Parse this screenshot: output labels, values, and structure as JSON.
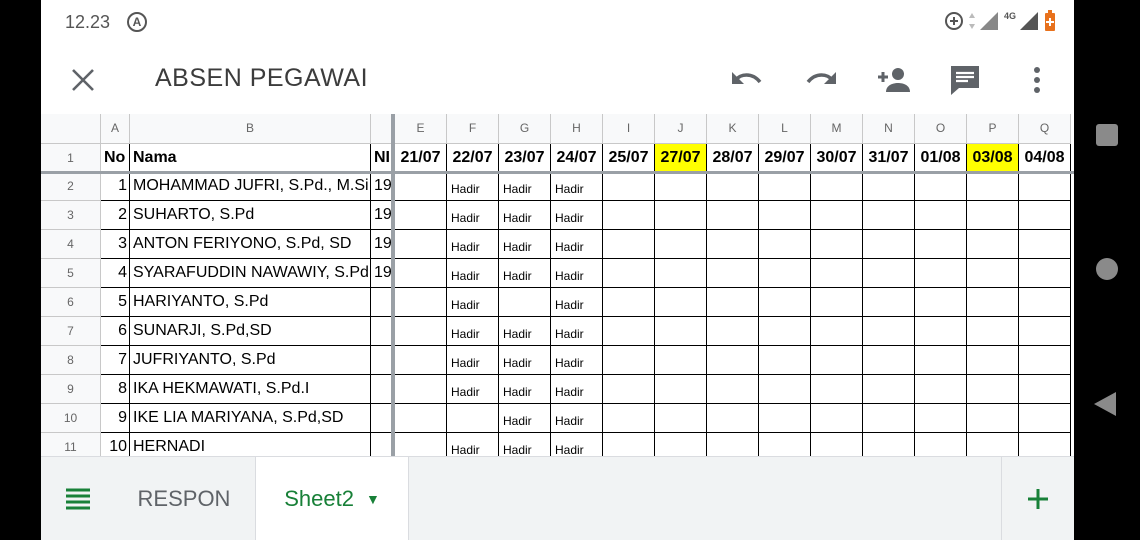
{
  "status": {
    "time": "12.23",
    "a_icon": "A",
    "network": "4G"
  },
  "toolbar": {
    "title": "ABSEN PEGAWAI"
  },
  "sheet": {
    "col_letters": [
      "A",
      "B",
      "",
      "E",
      "F",
      "G",
      "H",
      "I",
      "J",
      "K",
      "L",
      "M",
      "N",
      "O",
      "P",
      "Q"
    ],
    "header_row": {
      "row_num": "1",
      "no": "No",
      "nama": "Nama",
      "ni": "NI",
      "dates": [
        "21/07",
        "22/07",
        "23/07",
        "24/07",
        "25/07",
        "27/07",
        "28/07",
        "29/07",
        "30/07",
        "31/07",
        "01/08",
        "03/08",
        "04/08"
      ],
      "highlighted": [
        "27/07",
        "03/08"
      ],
      "highlight_color": "#ffff00"
    },
    "rows": [
      {
        "row_num": "2",
        "no": "1",
        "nama": "MOHAMMAD JUFRI, S.Pd., M.Si",
        "ni": "19",
        "att": [
          "",
          "Hadir",
          "Hadir",
          "Hadir"
        ]
      },
      {
        "row_num": "3",
        "no": "2",
        "nama": "SUHARTO, S.Pd",
        "ni": "19",
        "att": [
          "",
          "Hadir",
          "Hadir",
          "Hadir"
        ]
      },
      {
        "row_num": "4",
        "no": "3",
        "nama": "ANTON FERIYONO, S.Pd, SD",
        "ni": "19",
        "att": [
          "",
          "Hadir",
          "Hadir",
          "Hadir"
        ]
      },
      {
        "row_num": "5",
        "no": "4",
        "nama": "SYARAFUDDIN NAWAWIY, S.Pd.I",
        "ni": "19",
        "att": [
          "",
          "Hadir",
          "Hadir",
          "Hadir"
        ]
      },
      {
        "row_num": "6",
        "no": "5",
        "nama": "HARIYANTO, S.Pd",
        "ni": "",
        "att": [
          "",
          "Hadir",
          "",
          "Hadir"
        ]
      },
      {
        "row_num": "7",
        "no": "6",
        "nama": "SUNARJI, S.Pd,SD",
        "ni": "",
        "att": [
          "",
          "Hadir",
          "Hadir",
          "Hadir"
        ]
      },
      {
        "row_num": "8",
        "no": "7",
        "nama": "JUFRIYANTO, S.Pd",
        "ni": "",
        "att": [
          "",
          "Hadir",
          "Hadir",
          "Hadir"
        ]
      },
      {
        "row_num": "9",
        "no": "8",
        "nama": "IKA HEKMAWATI, S.Pd.I",
        "ni": "",
        "att": [
          "",
          "Hadir",
          "Hadir",
          "Hadir"
        ]
      },
      {
        "row_num": "10",
        "no": "9",
        "nama": "IKE LIA MARIYANA, S.Pd,SD",
        "ni": "",
        "att": [
          "",
          "",
          "Hadir",
          "Hadir"
        ]
      },
      {
        "row_num": "11",
        "no": "10",
        "nama": "HERNADI",
        "ni": "",
        "att": [
          "",
          "Hadir",
          "Hadir",
          "Hadir"
        ]
      }
    ]
  },
  "tabs": {
    "respon": "RESPON",
    "sheet2": "Sheet2",
    "sheet2_caret": "▼"
  },
  "icons": [
    "close-icon",
    "undo-icon",
    "redo-icon",
    "add-person-icon",
    "comment-icon",
    "more-vert-icon",
    "sheets-menu-icon",
    "add-sheet-icon"
  ],
  "colors": {
    "accent_green": "#188038",
    "yellow": "#ffff00"
  }
}
